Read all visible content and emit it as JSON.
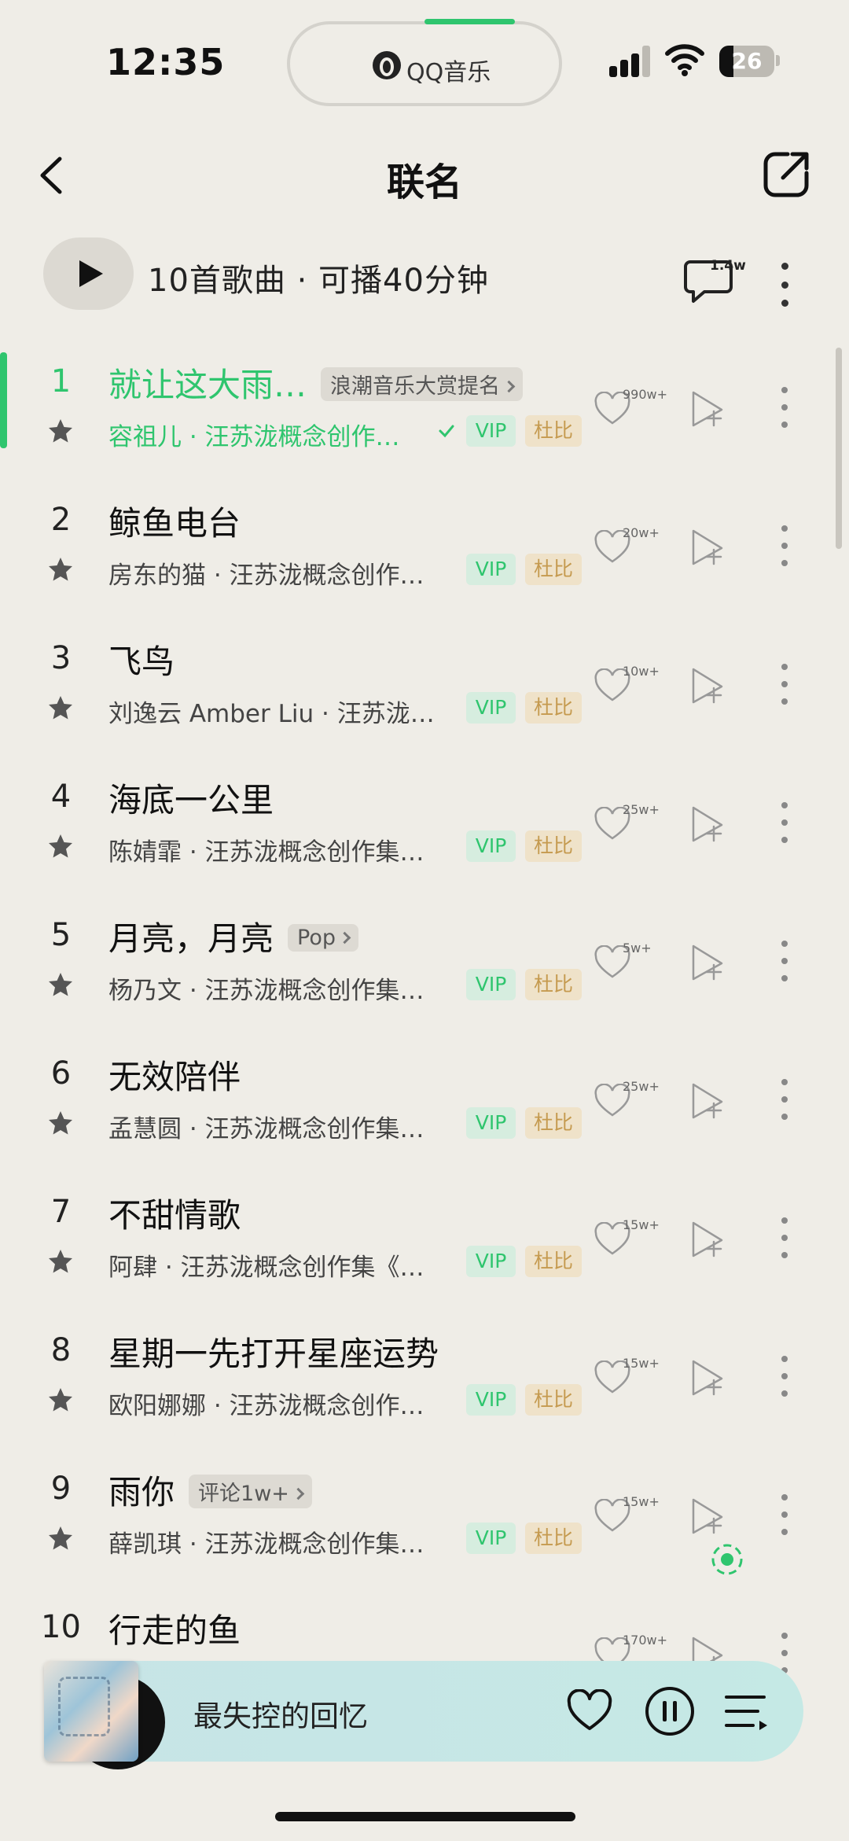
{
  "status_bar": {
    "time": "12:35",
    "island_app": "QQ音乐",
    "battery": "26",
    "battery_level": 0.26
  },
  "header": {
    "title": "联名"
  },
  "summary": {
    "text": "10首歌曲 · 可播40分钟",
    "comment_count": "1.4w"
  },
  "songs": [
    {
      "index": "1",
      "name": "就让这大雨…",
      "tag": "浪潮音乐大赏提名",
      "artist": "容祖儿 · 汪苏泷概念创作…",
      "verified": true,
      "vip": "VIP",
      "dolby": "杜比",
      "likes": "990w+",
      "playing": true
    },
    {
      "index": "2",
      "name": "鲸鱼电台",
      "tag": "",
      "artist": "房东的猫 · 汪苏泷概念创作…",
      "vip": "VIP",
      "dolby": "杜比",
      "likes": "20w+"
    },
    {
      "index": "3",
      "name": "飞鸟",
      "tag": "",
      "artist": "刘逸云 Amber Liu · 汪苏泷…",
      "vip": "VIP",
      "dolby": "杜比",
      "likes": "10w+"
    },
    {
      "index": "4",
      "name": "海底一公里",
      "tag": "",
      "artist": "陈婧霏 · 汪苏泷概念创作集…",
      "vip": "VIP",
      "dolby": "杜比",
      "likes": "25w+"
    },
    {
      "index": "5",
      "name": "月亮，月亮",
      "tag": "Pop",
      "artist": "杨乃文 · 汪苏泷概念创作集…",
      "vip": "VIP",
      "dolby": "杜比",
      "likes": "5w+"
    },
    {
      "index": "6",
      "name": "无效陪伴",
      "tag": "",
      "artist": "孟慧圆 · 汪苏泷概念创作集…",
      "vip": "VIP",
      "dolby": "杜比",
      "likes": "25w+"
    },
    {
      "index": "7",
      "name": "不甜情歌",
      "tag": "",
      "artist": "阿肆 · 汪苏泷概念创作集《…",
      "vip": "VIP",
      "dolby": "杜比",
      "likes": "15w+"
    },
    {
      "index": "8",
      "name": "星期一先打开星座运势",
      "tag": "",
      "artist": "欧阳娜娜 · 汪苏泷概念创作…",
      "vip": "VIP",
      "dolby": "杜比",
      "likes": "15w+"
    },
    {
      "index": "9",
      "name": "雨你",
      "tag": "评论1w+",
      "artist": "薛凯琪 · 汪苏泷概念创作集…",
      "vip": "VIP",
      "dolby": "杜比",
      "likes": "15w+"
    },
    {
      "index": "10",
      "name": "行走的鱼",
      "tag": "",
      "artist": "",
      "vip": "",
      "dolby": "",
      "likes": "170w+"
    }
  ],
  "player": {
    "now_playing": "最失控的回忆"
  },
  "colors": {
    "accent": "#2fc56e",
    "background": "#efede7",
    "vip_bg": "#d6eddf",
    "dolby_text": "#c59a4f"
  }
}
